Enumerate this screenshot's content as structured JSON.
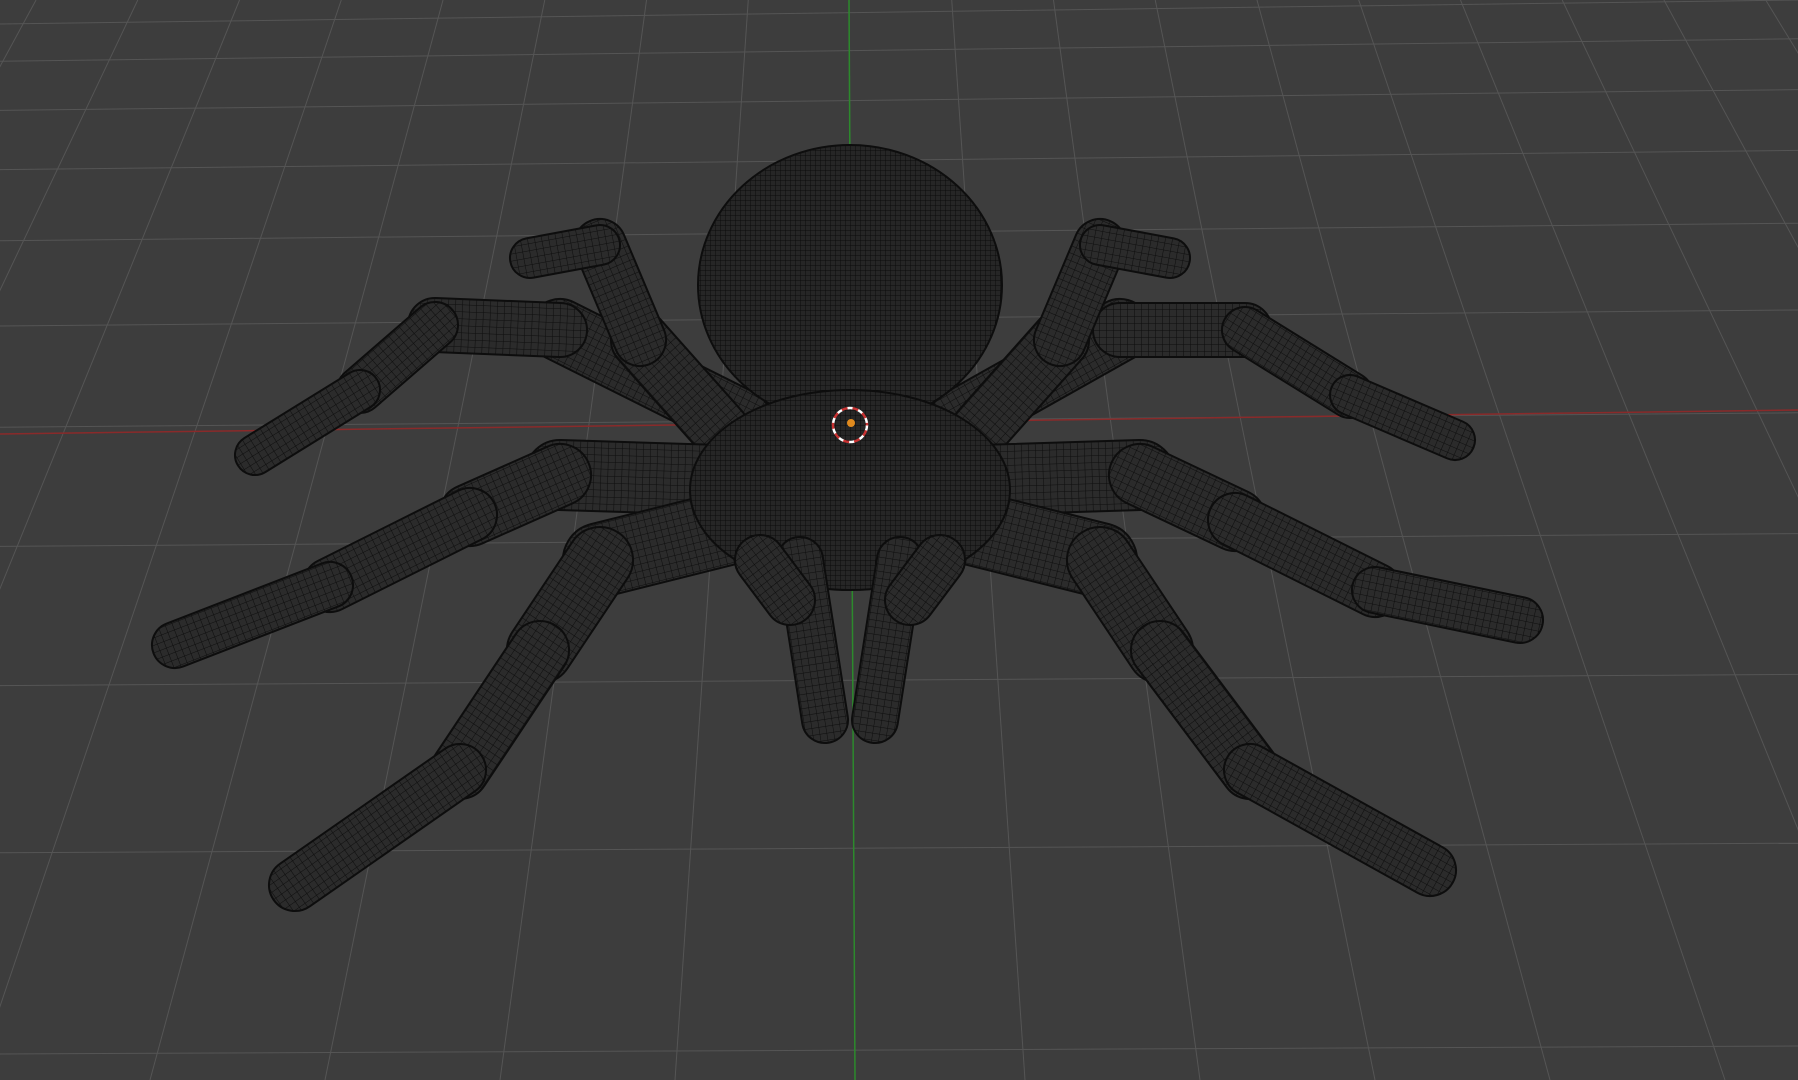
{
  "viewport": {
    "shading_mode": "wireframe",
    "background_color": "#3d3d3d",
    "grid_color": "#555555",
    "x_axis_color": "#8a2a2a",
    "y_axis_color": "#2c8a2c",
    "wire_color": "#101010",
    "mesh_fill_color": "#2a2a2a",
    "origin_color": "#e08a1e",
    "cursor_color_primary": "#ffffff",
    "cursor_color_secondary": "#c83232"
  },
  "scene": {
    "object": "spider-mesh",
    "legs_per_side": 4,
    "has_3d_cursor": true,
    "has_object_origin": true
  }
}
